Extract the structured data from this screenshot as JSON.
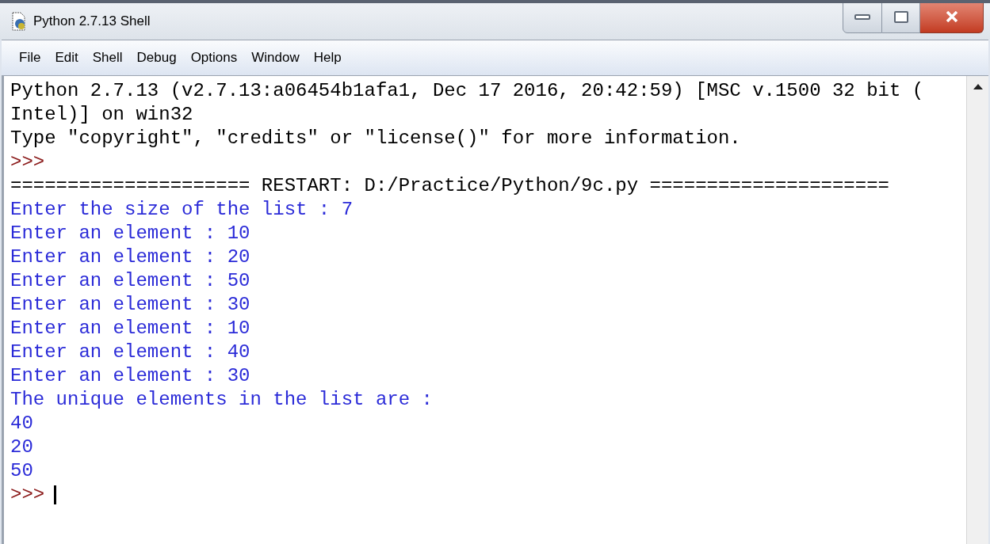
{
  "window": {
    "title": "Python 2.7.13 Shell"
  },
  "menu": [
    "File",
    "Edit",
    "Shell",
    "Debug",
    "Options",
    "Window",
    "Help"
  ],
  "lines": [
    {
      "kind": "output",
      "text": "Python 2.7.13 (v2.7.13:a06454b1afa1, Dec 17 2016, 20:42:59) [MSC v.1500 32 bit ("
    },
    {
      "kind": "output",
      "text": "Intel)] on win32"
    },
    {
      "kind": "output",
      "text": "Type \"copyright\", \"credits\" or \"license()\" for more information."
    },
    {
      "kind": "prompt",
      "text": ">>>"
    },
    {
      "kind": "output",
      "text": "===================== RESTART: D:/Practice/Python/9c.py ====================="
    },
    {
      "kind": "stdout",
      "text": "Enter the size of the list : 7"
    },
    {
      "kind": "stdout",
      "text": "Enter an element : 10"
    },
    {
      "kind": "stdout",
      "text": "Enter an element : 20"
    },
    {
      "kind": "stdout",
      "text": "Enter an element : 50"
    },
    {
      "kind": "stdout",
      "text": "Enter an element : 30"
    },
    {
      "kind": "stdout",
      "text": "Enter an element : 10"
    },
    {
      "kind": "stdout",
      "text": "Enter an element : 40"
    },
    {
      "kind": "stdout",
      "text": "Enter an element : 30"
    },
    {
      "kind": "stdout",
      "text": "The unique elements in the list are :"
    },
    {
      "kind": "stdout",
      "text": "40"
    },
    {
      "kind": "stdout",
      "text": "20"
    },
    {
      "kind": "stdout",
      "text": "50"
    },
    {
      "kind": "prompt",
      "text": ">>>",
      "cursor": true
    }
  ]
}
